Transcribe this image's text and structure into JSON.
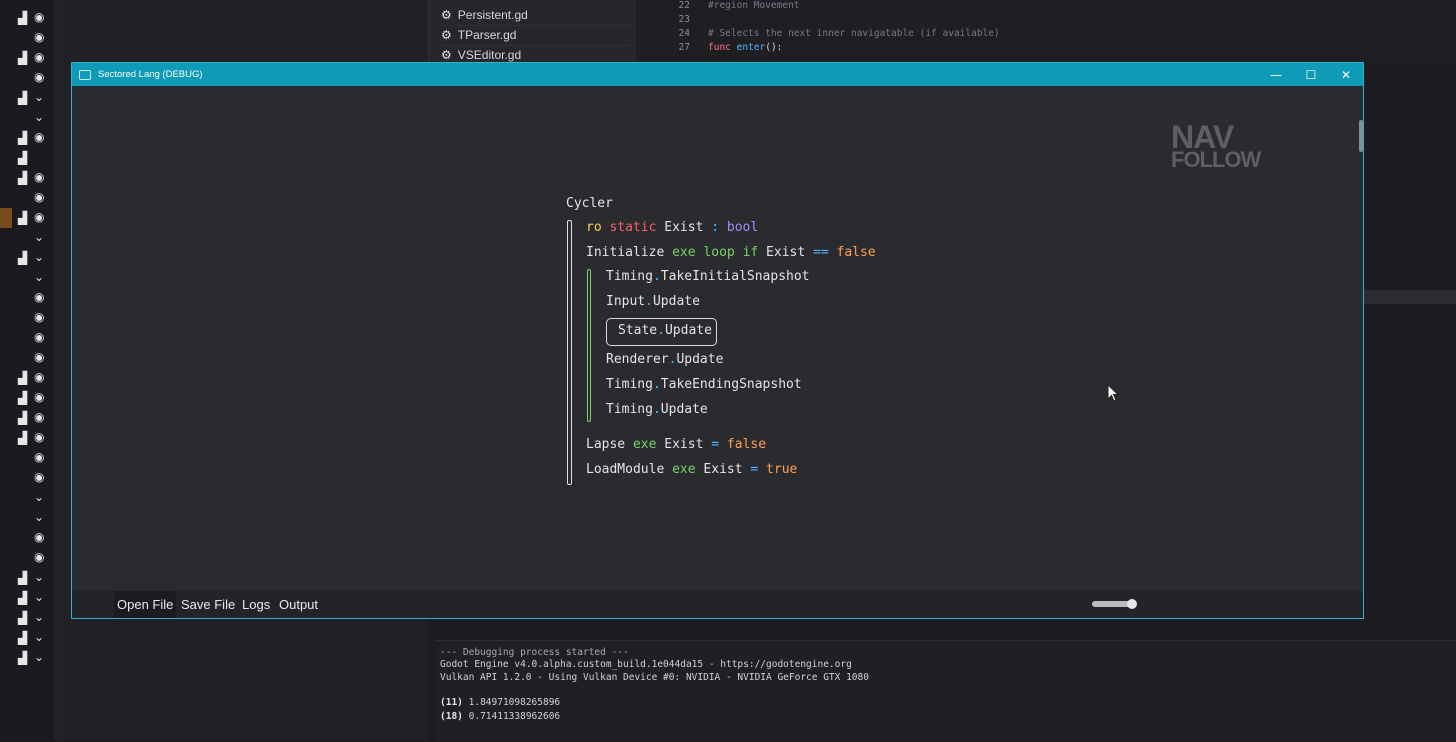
{
  "background": {
    "files": [
      "Persistent.gd",
      "TParser.gd",
      "VSEditor.gd"
    ],
    "code_lines": [
      {
        "num": "22",
        "text": "#region Movement"
      },
      {
        "num": "23",
        "text": ""
      },
      {
        "num": "24",
        "text": "# Selects the next inner navigatable (if available)"
      },
      {
        "num": "27",
        "func_kw": "func",
        "func_name": "enter",
        "tail": "():"
      }
    ],
    "console": {
      "header": "--- Debugging process started ---",
      "engine": "Godot Engine v4.0.alpha.custom_build.1e044da15 - https://godotengine.org",
      "vulkan": "Vulkan API 1.2.0 - Using Vulkan Device #0: NVIDIA - NVIDIA GeForce GTX 1080",
      "entries": [
        {
          "id": "(11)",
          "value": "1.84971098265896"
        },
        {
          "id": "(18)",
          "value": "0.71411338962606"
        }
      ]
    }
  },
  "window": {
    "title": "Sectored Lang (DEBUG)",
    "controls": {
      "minimize": "—",
      "maximize": "☐",
      "close": "✕"
    },
    "logo": {
      "line1": "NAV",
      "line2": "FOLLOW"
    },
    "program": {
      "name": "Cycler",
      "decl": {
        "ro": "ro",
        "static": "static",
        "name": "Exist",
        "colon": ":",
        "type": "bool"
      },
      "init": {
        "name": "Initialize",
        "exe": "exe",
        "loop": "loop",
        "if": "if",
        "var": "Exist",
        "op": "==",
        "val": "false"
      },
      "loop_body": [
        {
          "obj": "Timing",
          "method": "TakeInitialSnapshot"
        },
        {
          "obj": "Input",
          "method": "Update"
        },
        {
          "obj": "State",
          "method": "Update"
        },
        {
          "obj": "Renderer",
          "method": "Update"
        },
        {
          "obj": "Timing",
          "method": "TakeEndingSnapshot"
        },
        {
          "obj": "Timing",
          "method": "Update"
        }
      ],
      "lapse": {
        "name": "Lapse",
        "exe": "exe",
        "var": "Exist",
        "op": "=",
        "val": "false"
      },
      "load": {
        "name": "LoadModule",
        "exe": "exe",
        "var": "Exist",
        "op": "=",
        "val": "true"
      }
    },
    "menu": [
      "Open File",
      "Save File",
      "Logs",
      "Output"
    ],
    "zoom": 0.9
  },
  "colors": {
    "titlebar": "#0f9bb8",
    "keyword_ro": "#ffcf4a",
    "keyword_static": "#ff5b6b",
    "type": "#a78bfa",
    "keyword_exe": "#77d06a",
    "operator": "#4fb6ff",
    "literal": "#ff9f50"
  }
}
